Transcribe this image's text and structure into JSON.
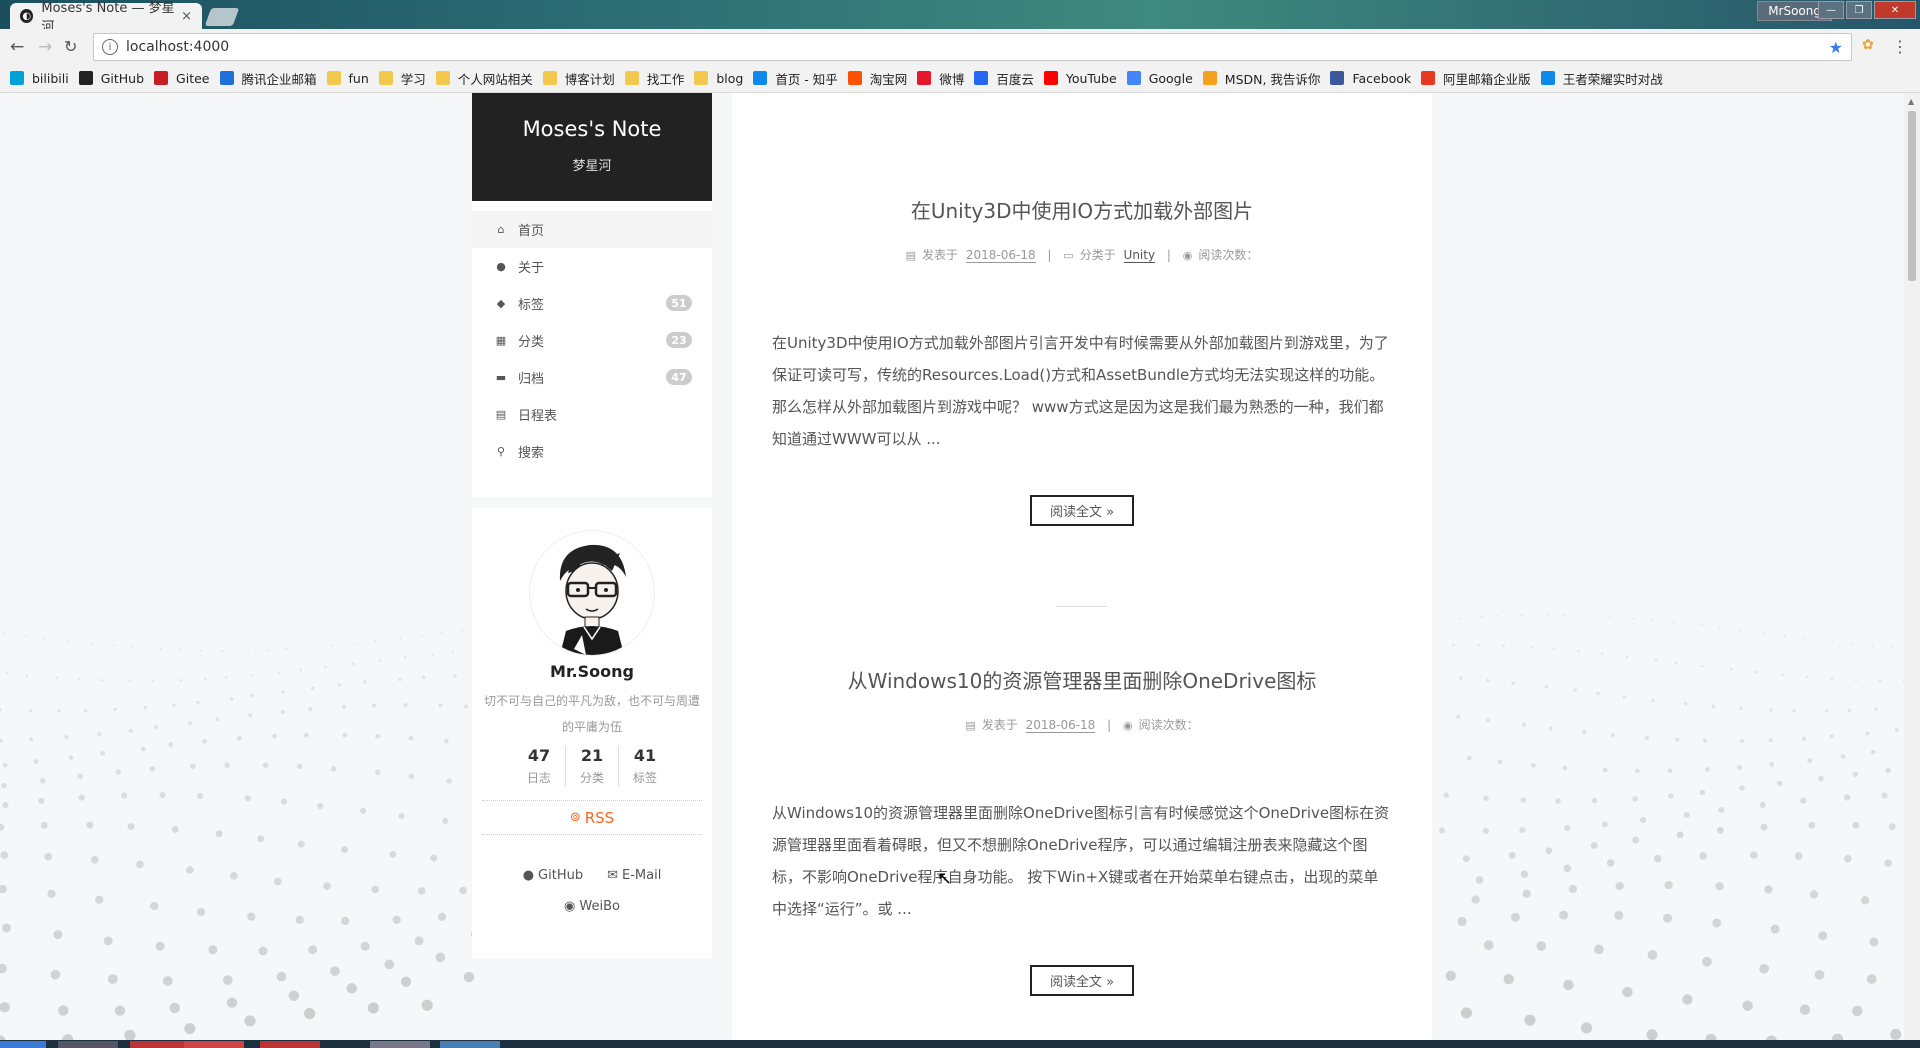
{
  "browser": {
    "tab_title": "Moses's Note — 梦星河",
    "tab_close": "×",
    "user": "MrSoong",
    "url": "localhost:4000",
    "bookmarks": [
      {
        "label": "bilibili",
        "icon": "bilibili-icon",
        "color": "#00a1d6"
      },
      {
        "label": "GitHub",
        "icon": "github-icon",
        "color": "#222222"
      },
      {
        "label": "Gitee",
        "icon": "gitee-icon",
        "color": "#c71d23"
      },
      {
        "label": "腾讯企业邮箱",
        "icon": "tencent-mail-icon",
        "color": "#1e6fd9"
      },
      {
        "label": "fun",
        "icon": "folder-icon",
        "color": "#f2c94c"
      },
      {
        "label": "学习",
        "icon": "folder-icon",
        "color": "#f2c94c"
      },
      {
        "label": "个人网站相关",
        "icon": "folder-icon",
        "color": "#f2c94c"
      },
      {
        "label": "博客计划",
        "icon": "folder-icon",
        "color": "#f2c94c"
      },
      {
        "label": "找工作",
        "icon": "folder-icon",
        "color": "#f2c94c"
      },
      {
        "label": "blog",
        "icon": "folder-icon",
        "color": "#f2c94c"
      },
      {
        "label": "首页 - 知乎",
        "icon": "zhihu-icon",
        "color": "#0f88eb"
      },
      {
        "label": "淘宝网",
        "icon": "taobao-icon",
        "color": "#ff5000"
      },
      {
        "label": "微博",
        "icon": "weibo-icon",
        "color": "#e6162d"
      },
      {
        "label": "百度云",
        "icon": "baidu-cloud-icon",
        "color": "#2468f2"
      },
      {
        "label": "YouTube",
        "icon": "youtube-icon",
        "color": "#ff0000"
      },
      {
        "label": "Google",
        "icon": "google-icon",
        "color": "#4285f4"
      },
      {
        "label": "MSDN, 我告诉你",
        "icon": "msdn-icon",
        "color": "#f4a020"
      },
      {
        "label": "Facebook",
        "icon": "facebook-icon",
        "color": "#3b5998"
      },
      {
        "label": "阿里邮箱企业版",
        "icon": "ali-mail-icon",
        "color": "#e8381f"
      },
      {
        "label": "王者荣耀实时对战",
        "icon": "zhihu-icon",
        "color": "#0f88eb"
      }
    ]
  },
  "site": {
    "title": "Moses's Note",
    "subtitle": "梦星河"
  },
  "menu": [
    {
      "label": "首页",
      "icon": "home-icon",
      "glyph": "⌂",
      "badge": ""
    },
    {
      "label": "关于",
      "icon": "user-icon",
      "glyph": "●",
      "badge": ""
    },
    {
      "label": "标签",
      "icon": "tags-icon",
      "glyph": "◆",
      "badge": "51"
    },
    {
      "label": "分类",
      "icon": "grid-icon",
      "glyph": "▦",
      "badge": "23"
    },
    {
      "label": "归档",
      "icon": "archive-icon",
      "glyph": "▬",
      "badge": "47"
    },
    {
      "label": "日程表",
      "icon": "calendar-icon",
      "glyph": "▤",
      "badge": ""
    },
    {
      "label": "搜索",
      "icon": "search-icon",
      "glyph": "⚲",
      "badge": ""
    }
  ],
  "profile": {
    "name": "Mr.Soong",
    "description": "切不可与自己的平凡为敌，也不可与周遭的平庸为伍",
    "stats": [
      {
        "num": "47",
        "label": "日志"
      },
      {
        "num": "21",
        "label": "分类"
      },
      {
        "num": "41",
        "label": "标签"
      }
    ],
    "rss": "RSS",
    "links": {
      "github": "GitHub",
      "email": "E-Mail",
      "weibo": "WeiBo"
    }
  },
  "posts": [
    {
      "title": "在Unity3D中使用IO方式加载外部图片",
      "posted_label": "发表于",
      "date": "2018-06-18",
      "category_label": "分类于",
      "category": "Unity",
      "views_label": "阅读次数：",
      "excerpt": "在Unity3D中使用IO方式加载外部图片引言开发中有时候需要从外部加载图片到游戏里，为了保证可读可写，传统的Resources.Load()方式和AssetBundle方式均无法实现这样的功能。那么怎样从外部加载图片到游戏中呢？ www方式这是因为这是我们最为熟悉的一种，我们都知道通过WWW可以从 ...",
      "read_more": "阅读全文 »"
    },
    {
      "title": "从Windows10的资源管理器里面删除OneDrive图标",
      "posted_label": "发表于",
      "date": "2018-06-18",
      "views_label": "阅读次数：",
      "excerpt": "从Windows10的资源管理器里面删除OneDrive图标引言有时候感觉这个OneDrive图标在资源管理器里面看着碍眼，但又不想删除OneDrive程序，可以通过编辑注册表来隐藏这个图标，不影响OneDrive程序自身功能。 按下Win+X键或者在开始菜单右键点击，出现的菜单中选择“运行”。或 ...",
      "read_more": "阅读全文 »"
    }
  ],
  "colors": {
    "accent": "#fc6423",
    "brand_bg": "#222222",
    "badge": "#cccccc"
  }
}
